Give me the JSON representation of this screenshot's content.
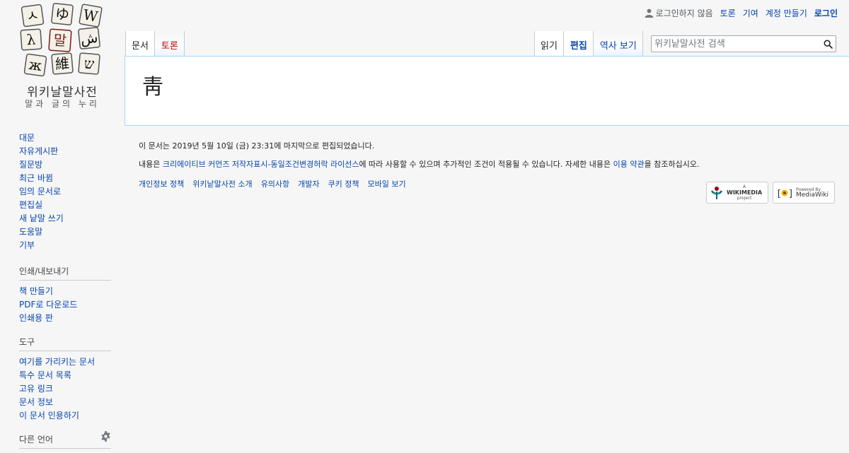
{
  "logo": {
    "tiles": [
      "ㅅ",
      "ゆ",
      "W",
      "λ",
      "말",
      "ش",
      "ж",
      "維",
      "ש"
    ],
    "name": "위키날말사전",
    "tagline": "말과 글의 누리"
  },
  "personal": {
    "anon": "로그인하지 않음",
    "talk": "토론",
    "contributions": "기여",
    "create_account": "계정 만들기",
    "login": "로그인"
  },
  "tabs": {
    "page": "문서",
    "talk": "토론",
    "read": "읽기",
    "edit": "편집",
    "history": "역사 보기"
  },
  "search": {
    "placeholder": "위키낱말사전 검색"
  },
  "page": {
    "title": "靑"
  },
  "navigation": {
    "items": [
      "대문",
      "자유게시판",
      "질문방",
      "최근 바뀜",
      "임의 문서로",
      "편집실",
      "새 낱말 쓰기",
      "도움말",
      "기부"
    ]
  },
  "print_export": {
    "heading": "인쇄/내보내기",
    "items": [
      "책 만들기",
      "PDF로 다운로드",
      "인쇄용 판"
    ]
  },
  "tools": {
    "heading": "도구",
    "items": [
      "여기를 가리키는 문서",
      "특수 문서 목록",
      "고유 링크",
      "문서 정보",
      "이 문서 인용하기"
    ]
  },
  "languages": {
    "heading": "다른 언어"
  },
  "footer": {
    "lastmod": "이 문서는 2019년 5월 10일 (금) 23:31에 마지막으로 편집되었습니다.",
    "license_prefix": "내용은 ",
    "license_link": "크리에이티브 커먼즈 저작자표시-동일조건변경허락 라이선스",
    "license_mid": "에 따라 사용할 수 있으며 추가적인 조건이 적용될 수 있습니다. 자세한 내용은 ",
    "terms_link": "이용 약관",
    "license_suffix": "을 참조하십시오.",
    "places": [
      "개인정보 정책",
      "위키낱말사전 소개",
      "유의사항",
      "개발자",
      "쿠키 정책",
      "모바일 보기"
    ],
    "wikimedia_badge": {
      "small": "A",
      "name": "WIKIMEDIA",
      "sub": "project"
    },
    "mediawiki_badge": {
      "small": "Powered By",
      "name": "MediaWiki"
    }
  },
  "colors": {
    "link": "#0645ad",
    "new_link": "#ba0000",
    "content_border": "#a7d7f9"
  }
}
